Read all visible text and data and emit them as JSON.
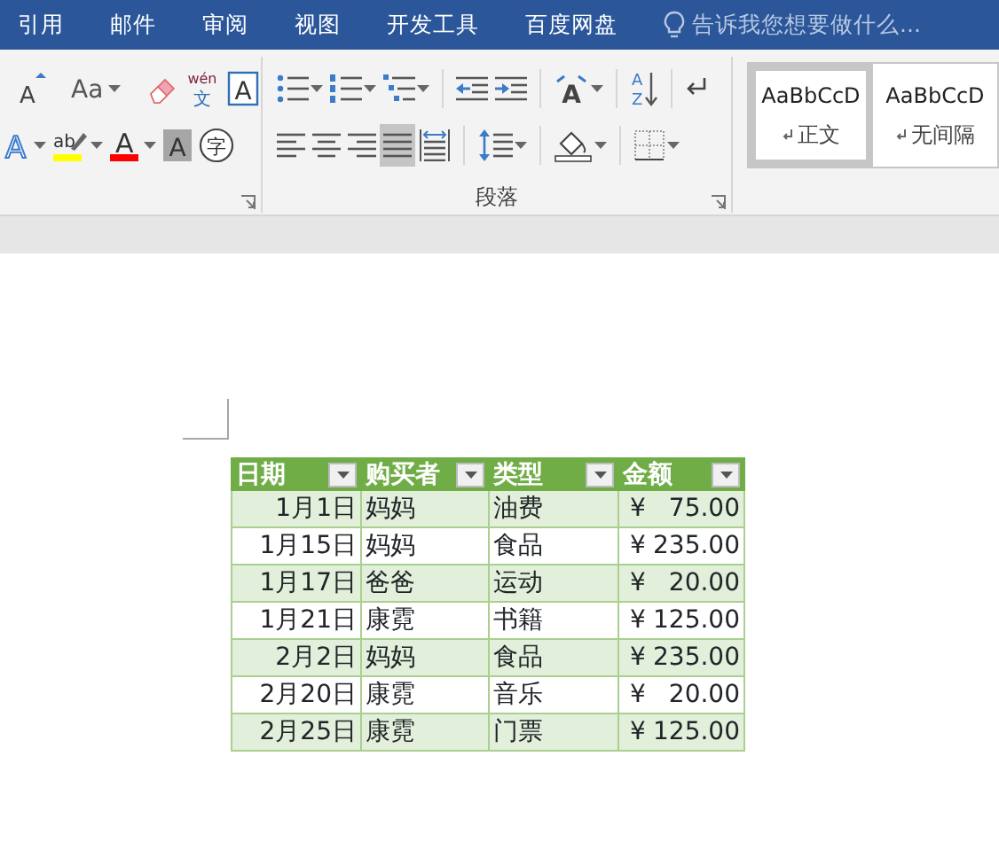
{
  "tabs": [
    {
      "label": "引用"
    },
    {
      "label": "邮件"
    },
    {
      "label": "审阅"
    },
    {
      "label": "视图"
    },
    {
      "label": "开发工具"
    },
    {
      "label": "百度网盘"
    }
  ],
  "tell_me": {
    "placeholder": "告诉我您想要做什么..."
  },
  "font_group": {
    "row_1": [
      {
        "kind": "grow",
        "glyph": "A"
      },
      {
        "kind": "case",
        "glyph": "Aa",
        "dropdown": true
      },
      {
        "kind": "eraser"
      },
      {
        "kind": "phonetic",
        "glyph": "wén",
        "sub": "文"
      },
      {
        "kind": "boxed",
        "glyph": "A"
      }
    ],
    "row_2": [
      {
        "kind": "outline",
        "glyph": "A",
        "dropdown": true
      },
      {
        "kind": "highlight",
        "glyph": "ab",
        "color": "#ffff00",
        "dropdown": true
      },
      {
        "kind": "fontcolor",
        "glyph": "A",
        "color": "#ff0000",
        "dropdown": true
      },
      {
        "kind": "shaded",
        "glyph": "A"
      },
      {
        "kind": "circled",
        "glyph": "字"
      }
    ]
  },
  "paragraph_group": {
    "label": "段落",
    "row_1": [
      {
        "kind": "bullets",
        "dropdown": true
      },
      {
        "kind": "numbering",
        "dropdown": true
      },
      {
        "kind": "multilevel",
        "dropdown": true
      },
      {
        "kind": "outdent"
      },
      {
        "kind": "indent"
      },
      {
        "kind": "asian",
        "glyph": "A",
        "dropdown": true
      },
      {
        "kind": "sort",
        "glyph": "A",
        "sub": "Z"
      },
      {
        "kind": "marks"
      }
    ],
    "alignment": [
      {
        "kind": "left",
        "selected": false
      },
      {
        "kind": "center",
        "selected": false
      },
      {
        "kind": "right",
        "selected": false
      },
      {
        "kind": "justify",
        "selected": true
      },
      {
        "kind": "distributed",
        "selected": false
      }
    ],
    "row_2": [
      {
        "kind": "spacing",
        "dropdown": true
      },
      {
        "kind": "shading",
        "dropdown": true
      },
      {
        "kind": "borders",
        "dropdown": true
      }
    ]
  },
  "styles": [
    {
      "sample": "AaBbCcD",
      "name": "正文",
      "selected": true
    },
    {
      "sample": "AaBbCcD",
      "name": "无间隔",
      "selected": false
    }
  ],
  "table": {
    "columns": [
      "日期",
      "购买者",
      "类型",
      "金额"
    ],
    "rows": [
      {
        "date": "1月1日",
        "buyer": "妈妈",
        "type": "油费",
        "currency": "¥",
        "amount": "75.00"
      },
      {
        "date": "1月15日",
        "buyer": "妈妈",
        "type": "食品",
        "currency": "¥",
        "amount": "235.00"
      },
      {
        "date": "1月17日",
        "buyer": "爸爸",
        "type": "运动",
        "currency": "¥",
        "amount": "20.00"
      },
      {
        "date": "1月21日",
        "buyer": "康霓",
        "type": "书籍",
        "currency": "¥",
        "amount": "125.00"
      },
      {
        "date": "2月2日",
        "buyer": "妈妈",
        "type": "食品",
        "currency": "¥",
        "amount": "235.00"
      },
      {
        "date": "2月20日",
        "buyer": "康霓",
        "type": "音乐",
        "currency": "¥",
        "amount": "20.00"
      },
      {
        "date": "2月25日",
        "buyer": "康霓",
        "type": "门票",
        "currency": "¥",
        "amount": "125.00"
      }
    ]
  }
}
